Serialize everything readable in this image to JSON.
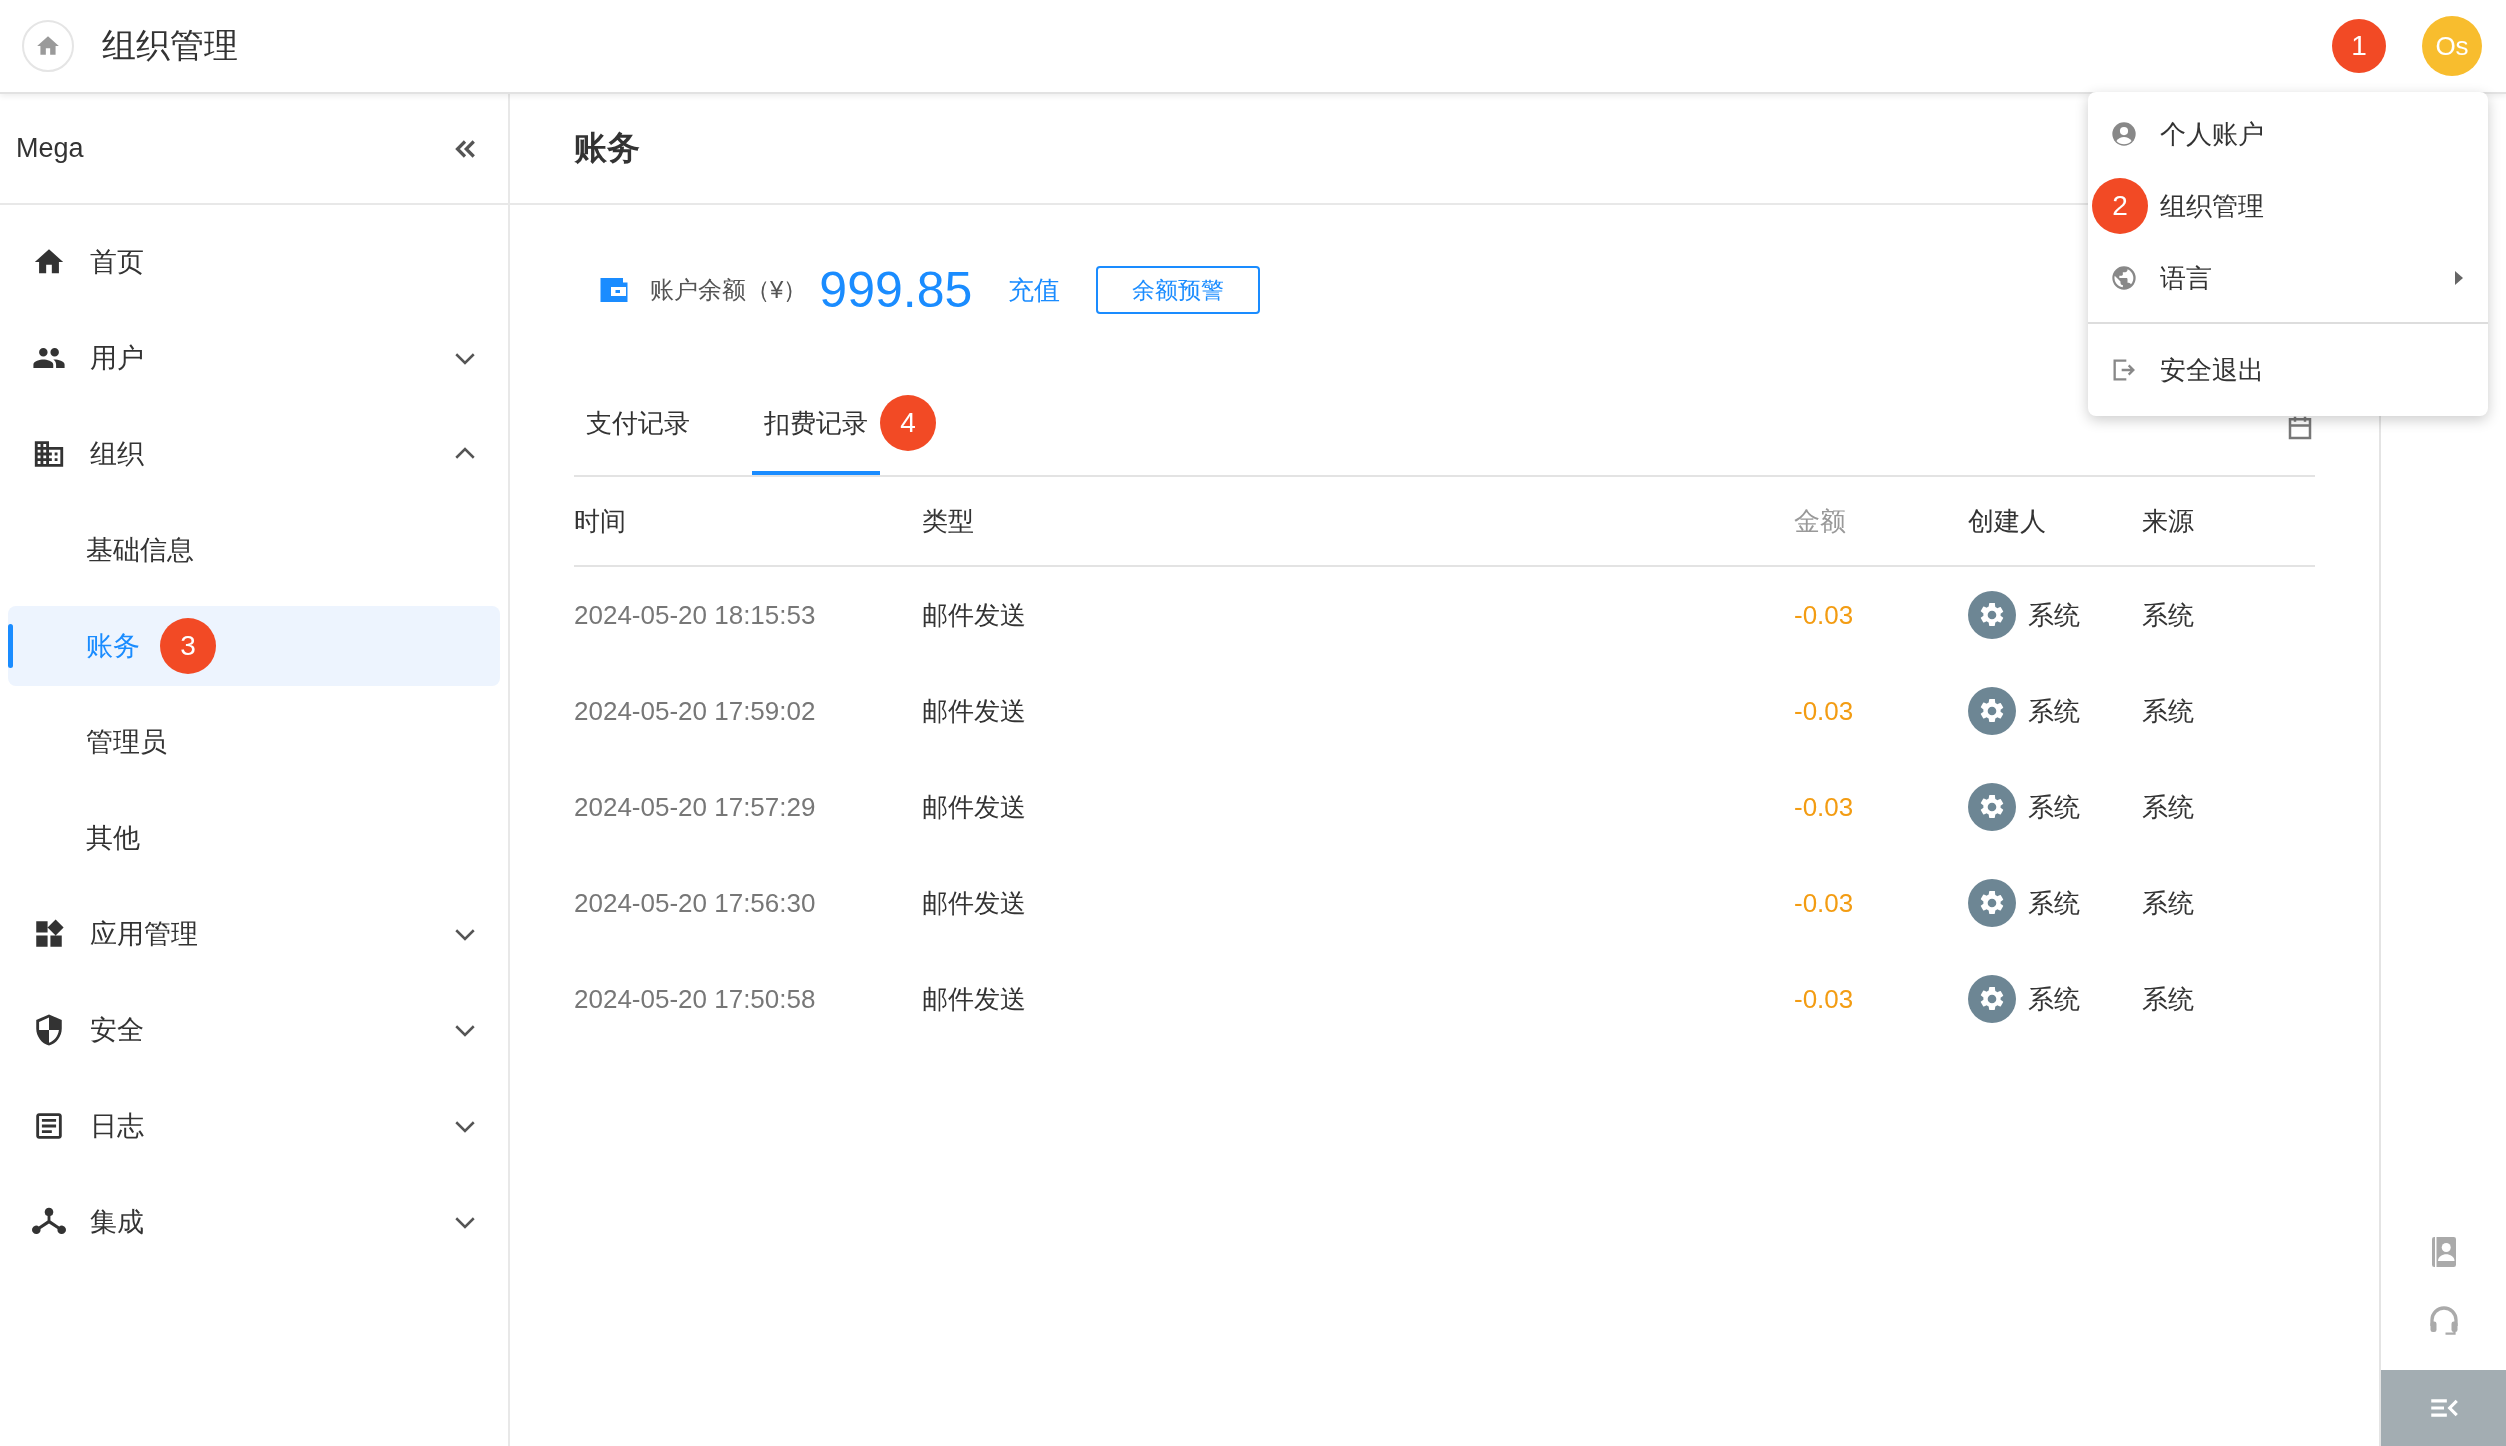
{
  "header": {
    "title": "组织管理",
    "marker": "1",
    "avatar": "Os"
  },
  "user_menu": {
    "items": [
      {
        "label": "个人账户",
        "kind": "profile",
        "has_submenu": false,
        "divider_before": false
      },
      {
        "label": "组织管理",
        "kind": "org",
        "marker": "2",
        "has_submenu": false,
        "divider_before": false
      },
      {
        "label": "语言",
        "kind": "language",
        "has_submenu": true,
        "divider_before": false
      },
      {
        "label": "安全退出",
        "kind": "logout",
        "has_submenu": false,
        "divider_before": true
      }
    ]
  },
  "sidebar": {
    "title": "Mega",
    "items": [
      {
        "label": "首页",
        "kind": "home",
        "selected": false
      },
      {
        "label": "用户",
        "kind": "users",
        "selected": false,
        "expanded": false
      },
      {
        "label": "组织",
        "kind": "org",
        "selected": false,
        "expanded": true,
        "children": [
          {
            "label": "基础信息",
            "selected": false
          },
          {
            "label": "账务",
            "selected": true,
            "marker": "3"
          },
          {
            "label": "管理员",
            "selected": false
          },
          {
            "label": "其他",
            "selected": false
          }
        ]
      },
      {
        "label": "应用管理",
        "kind": "apps",
        "selected": false,
        "expanded": false
      },
      {
        "label": "安全",
        "kind": "security",
        "selected": false,
        "expanded": false
      },
      {
        "label": "日志",
        "kind": "log",
        "selected": false,
        "expanded": false
      },
      {
        "label": "集成",
        "kind": "integration",
        "selected": false,
        "expanded": false
      }
    ]
  },
  "page": {
    "title": "账务",
    "balance": {
      "label": "账户余额（¥）",
      "amount": "999.85",
      "recharge": "充值",
      "alert_button": "余额预警"
    },
    "tabs": [
      {
        "label": "支付记录",
        "selected": false
      },
      {
        "label": "扣费记录",
        "selected": true,
        "marker": "4"
      }
    ],
    "table": {
      "columns": [
        "时间",
        "类型",
        "金额",
        "创建人",
        "来源"
      ],
      "rows": [
        [
          "2024-05-20 18:15:53",
          "邮件发送",
          "-0.03",
          "系统",
          "系统"
        ],
        [
          "2024-05-20 17:59:02",
          "邮件发送",
          "-0.03",
          "系统",
          "系统"
        ],
        [
          "2024-05-20 17:57:29",
          "邮件发送",
          "-0.03",
          "系统",
          "系统"
        ],
        [
          "2024-05-20 17:56:30",
          "邮件发送",
          "-0.03",
          "系统",
          "系统"
        ],
        [
          "2024-05-20 17:50:58",
          "邮件发送",
          "-0.03",
          "系统",
          "系统"
        ]
      ]
    }
  }
}
